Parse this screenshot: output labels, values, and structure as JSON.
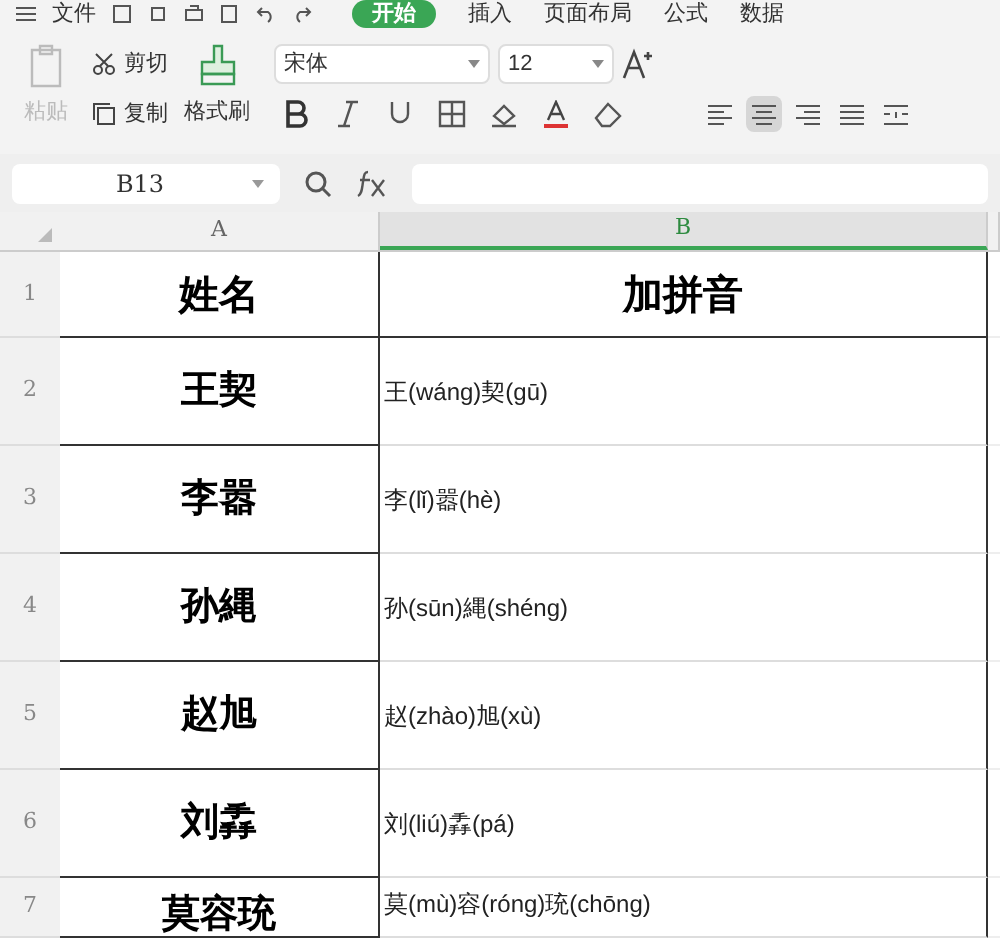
{
  "menu": {
    "file": "文件",
    "tabs": [
      {
        "label": "开始",
        "selected": true
      },
      {
        "label": "插入",
        "selected": false
      },
      {
        "label": "页面布局",
        "selected": false
      },
      {
        "label": "公式",
        "selected": false
      },
      {
        "label": "数据",
        "selected": false
      }
    ]
  },
  "ribbon": {
    "paste": {
      "label": "粘贴",
      "disabled": true
    },
    "cut": "剪切",
    "copy": "复制",
    "format_painter": "格式刷",
    "font": "宋体",
    "font_size": "12",
    "align": [
      {
        "kind": "left",
        "selected": false
      },
      {
        "kind": "center",
        "selected": true
      },
      {
        "kind": "right",
        "selected": false
      },
      {
        "kind": "justify",
        "selected": false
      },
      {
        "kind": "distributed",
        "selected": false
      }
    ]
  },
  "name_box": "B13",
  "columns": [
    {
      "label": "A",
      "selected": false
    },
    {
      "label": "B",
      "selected": true
    }
  ],
  "rows": [
    {
      "number": "1",
      "cells": [
        "姓名",
        "加拼音"
      ]
    },
    {
      "number": "2",
      "cells": [
        "王契",
        "王(wáng)契(gū)"
      ]
    },
    {
      "number": "3",
      "cells": [
        "李嚣",
        "李(lǐ)嚣(hè)"
      ]
    },
    {
      "number": "4",
      "cells": [
        "孙縄",
        "孙(sūn)縄(shéng)"
      ]
    },
    {
      "number": "5",
      "cells": [
        "赵旭",
        "赵(zhào)旭(xù)"
      ]
    },
    {
      "number": "6",
      "cells": [
        "刘掱",
        "刘(liú)掱(pá)"
      ]
    },
    {
      "number": "7",
      "cells": [
        "莫容珫",
        "莫(mù)容(róng)珫(chōng)"
      ]
    }
  ]
}
